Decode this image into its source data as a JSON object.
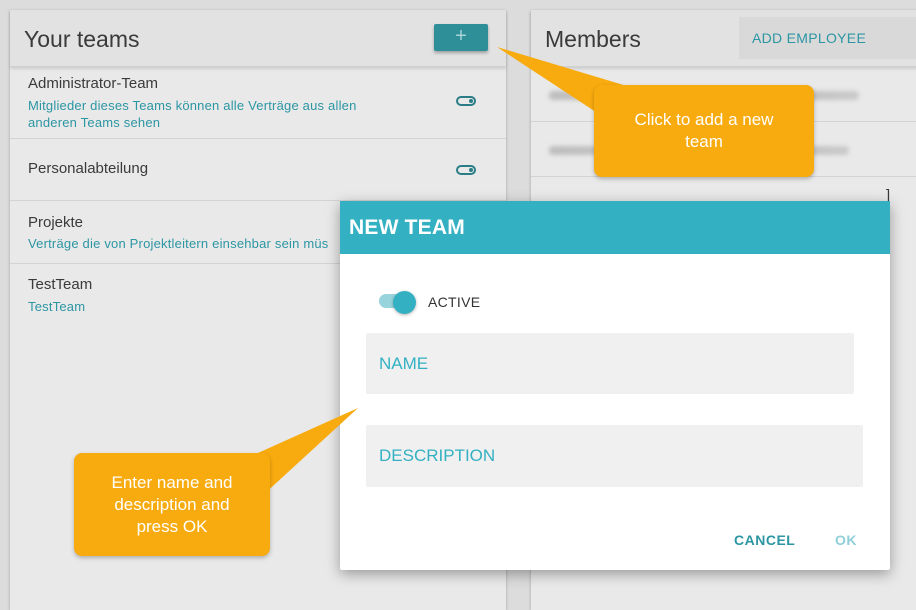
{
  "teams_panel": {
    "title": "Your teams",
    "add_button_label": "+",
    "teams": [
      {
        "name": "Administrator-Team",
        "description": "Mitglieder dieses Teams können alle Verträge aus allen anderen Teams sehen"
      },
      {
        "name": "Personalabteilung",
        "description": ""
      },
      {
        "name": "Projekte",
        "description": "Verträge die von Projektleitern einsehbar sein müs"
      },
      {
        "name": "TestTeam",
        "description": "TestTeam"
      }
    ]
  },
  "members_panel": {
    "title": "Members",
    "add_employee_label": "ADD EMPLOYEE",
    "partial_text": "]"
  },
  "modal": {
    "title": "NEW TEAM",
    "active_label": "ACTIVE",
    "active": true,
    "name_placeholder": "NAME",
    "description_placeholder": "DESCRIPTION",
    "cancel_label": "CANCEL",
    "ok_label": "OK"
  },
  "callouts": {
    "add_team": "Click to add a new team",
    "enter_name": "Enter name and description and press OK"
  },
  "colors": {
    "accent": "#33b1c2",
    "callout": "#f8ab0f",
    "dark_teal": "#2f8f99"
  }
}
